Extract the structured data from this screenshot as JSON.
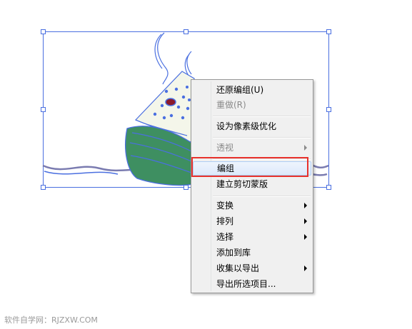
{
  "menu": {
    "items": [
      {
        "label": "还原编组(U)",
        "disabled": false
      },
      {
        "label": "重做(R)",
        "disabled": true
      },
      {
        "label": "设为像素级优化",
        "disabled": false
      },
      {
        "label": "透视",
        "disabled": true,
        "submenu": true
      },
      {
        "label": "编组",
        "disabled": false,
        "hovered": true
      },
      {
        "label": "建立剪切蒙版",
        "disabled": false
      },
      {
        "label": "变换",
        "disabled": false,
        "submenu": true
      },
      {
        "label": "排列",
        "disabled": false,
        "submenu": true
      },
      {
        "label": "选择",
        "disabled": false,
        "submenu": true
      },
      {
        "label": "添加到库",
        "disabled": false
      },
      {
        "label": "收集以导出",
        "disabled": false,
        "submenu": true
      },
      {
        "label": "导出所选项目...",
        "disabled": false
      }
    ]
  },
  "annotation": {
    "highlight_color": "#e8322c",
    "target": "编组"
  },
  "watermark": "软件自学网：RJZXW.COM",
  "colors": {
    "selection": "#4a6fe0",
    "leaf": "#3e8f61",
    "leaf_stroke": "#4a6fe0",
    "rice": "#f4f6ea",
    "dots": "#4a6fe0",
    "date": "#8b1a2b"
  }
}
